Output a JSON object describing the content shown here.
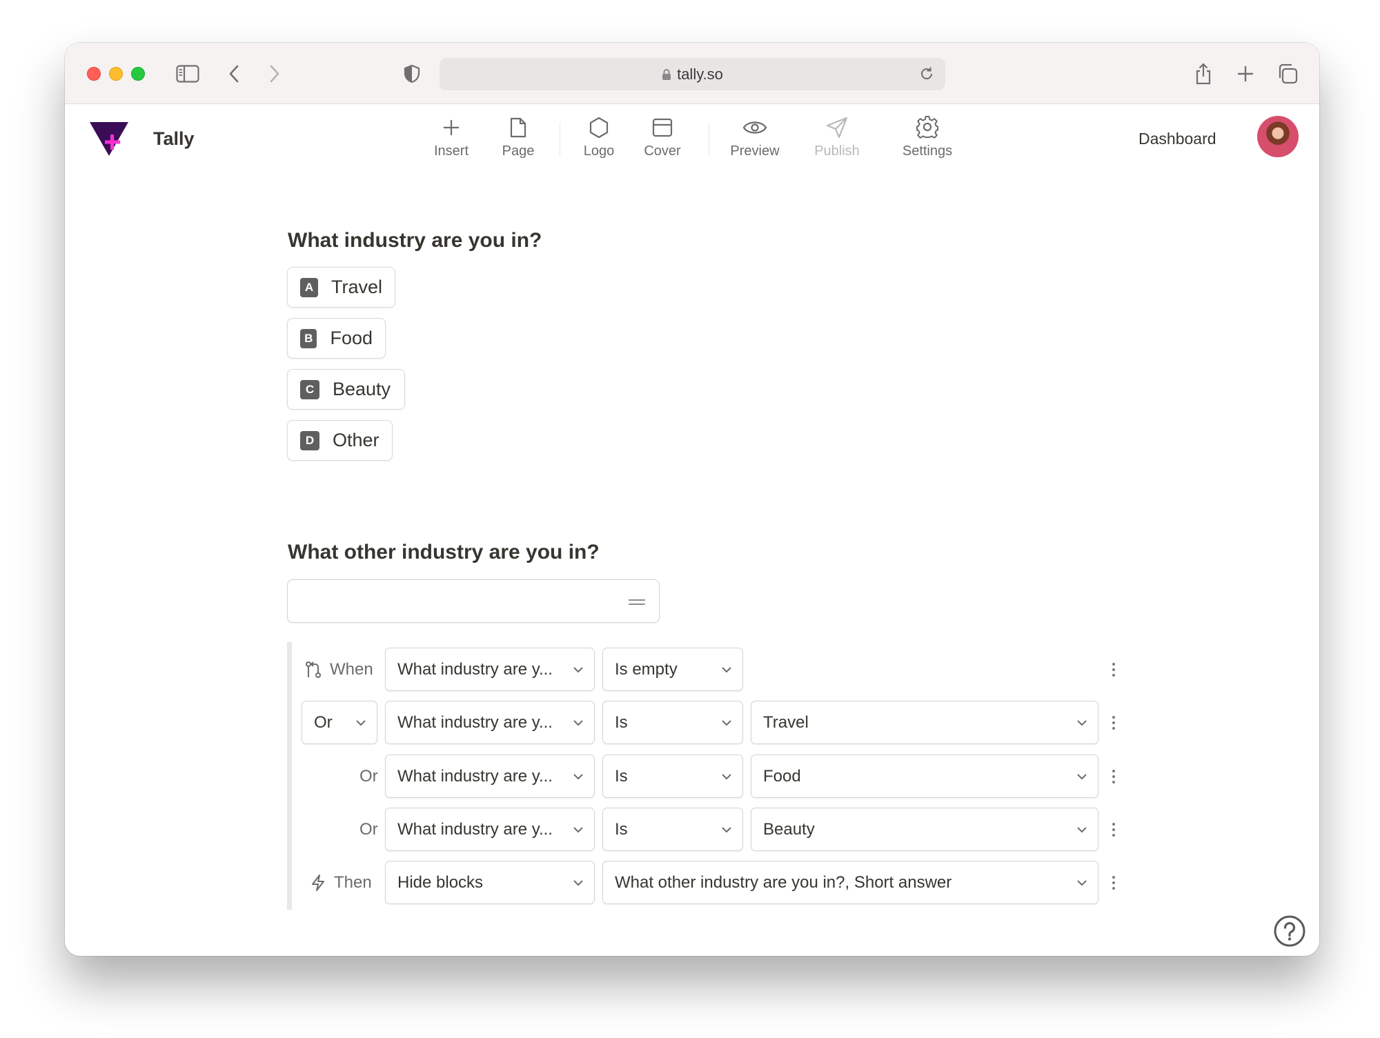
{
  "browser": {
    "url": "tally.so"
  },
  "app": {
    "brand": "Tally",
    "toolbar": [
      {
        "label": "Insert",
        "icon": "plus-icon",
        "disabled": false
      },
      {
        "label": "Page",
        "icon": "page-icon",
        "disabled": false
      },
      {
        "label": "Logo",
        "icon": "hexagon-icon",
        "disabled": false
      },
      {
        "label": "Cover",
        "icon": "cover-icon",
        "disabled": false
      },
      {
        "label": "Preview",
        "icon": "eye-icon",
        "disabled": false
      },
      {
        "label": "Publish",
        "icon": "send-icon",
        "disabled": true
      },
      {
        "label": "Settings",
        "icon": "gear-icon",
        "disabled": false
      }
    ],
    "dashboard_label": "Dashboard"
  },
  "form": {
    "question1": {
      "title": "What industry are you in?",
      "choices": [
        {
          "key": "A",
          "label": "Travel"
        },
        {
          "key": "B",
          "label": "Food"
        },
        {
          "key": "C",
          "label": "Beauty"
        },
        {
          "key": "D",
          "label": "Other"
        }
      ]
    },
    "question2": {
      "title": "What other industry are you in?"
    },
    "logic": {
      "when_label": "When",
      "then_label": "Then",
      "rows": [
        {
          "connector": "When",
          "field": "What industry are y...",
          "operator": "Is empty",
          "value": ""
        },
        {
          "connector": "Or",
          "field": "What industry are y...",
          "operator": "Is",
          "value": "Travel"
        },
        {
          "connector": "Or",
          "field": "What industry are y...",
          "operator": "Is",
          "value": "Food"
        },
        {
          "connector": "Or",
          "field": "What industry are y...",
          "operator": "Is",
          "value": "Beauty"
        }
      ],
      "action": {
        "type": "Hide blocks",
        "target": "What other industry are you in?, Short answer"
      }
    }
  },
  "colors": {
    "brand_purple": "#3b0d57",
    "brand_pink": "#ff2fd3",
    "disabled_text": "#b9b9b9"
  }
}
